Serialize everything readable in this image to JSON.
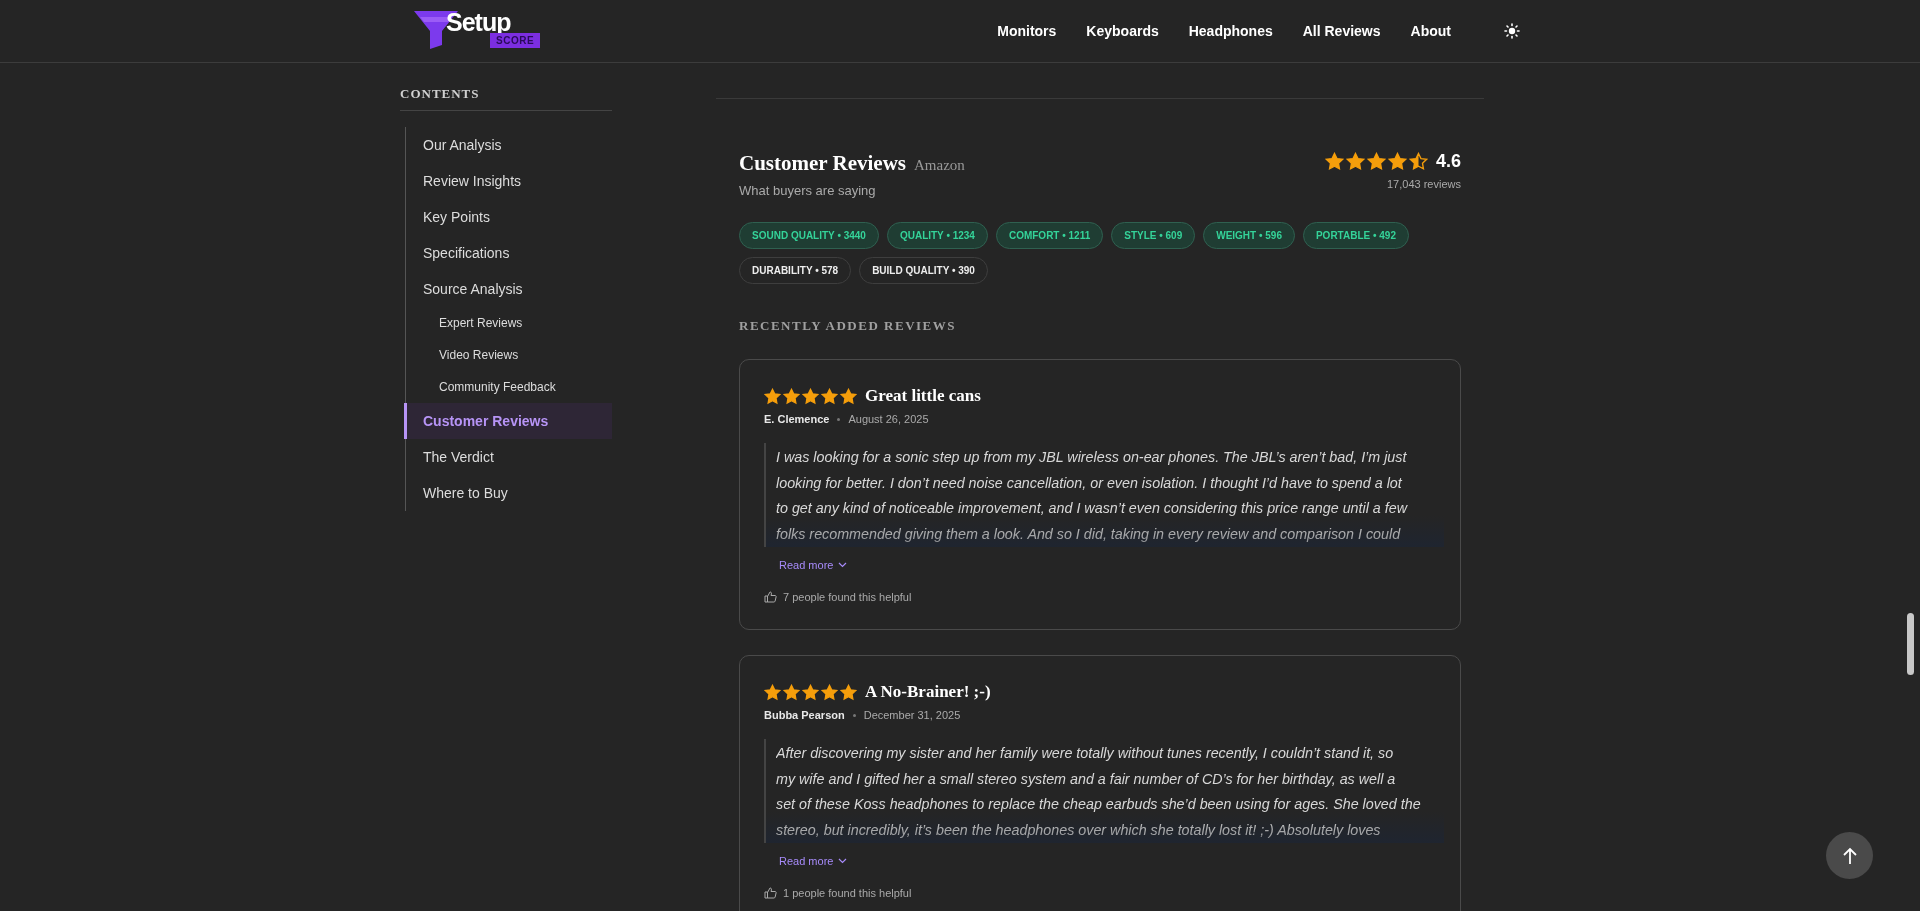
{
  "header": {
    "logo": {
      "word": "Setup",
      "badge": "SCORE"
    },
    "nav": [
      {
        "label": "Monitors"
      },
      {
        "label": "Keyboards"
      },
      {
        "label": "Headphones"
      },
      {
        "label": "All Reviews"
      },
      {
        "label": "About"
      }
    ]
  },
  "sidebar": {
    "title": "CONTENTS",
    "items": [
      {
        "label": "Our Analysis",
        "selected": false
      },
      {
        "label": "Review Insights",
        "selected": false
      },
      {
        "label": "Key Points",
        "selected": false
      },
      {
        "label": "Specifications",
        "selected": false
      },
      {
        "label": "Source Analysis",
        "selected": false,
        "children": [
          {
            "label": "Expert Reviews",
            "selected": false
          },
          {
            "label": "Video Reviews",
            "selected": false
          },
          {
            "label": "Community Feedback",
            "selected": false
          }
        ]
      },
      {
        "label": "Customer Reviews",
        "selected": true
      },
      {
        "label": "The Verdict",
        "selected": false
      },
      {
        "label": "Where to Buy",
        "selected": false
      }
    ]
  },
  "customer_reviews": {
    "title": "Customer Reviews",
    "source": "Amazon",
    "subtitle": "What buyers are saying",
    "stars": 4.5,
    "rating": "4.6",
    "count": "17,043 reviews",
    "tags": [
      {
        "label": "SOUND QUALITY • 3440",
        "highlighted": true
      },
      {
        "label": "QUALITY • 1234",
        "highlighted": true
      },
      {
        "label": "COMFORT • 1211",
        "highlighted": true
      },
      {
        "label": "STYLE • 609",
        "highlighted": true
      },
      {
        "label": "WEIGHT • 596",
        "highlighted": true
      },
      {
        "label": "PORTABLE • 492",
        "highlighted": true
      },
      {
        "label": "DURABILITY • 578",
        "highlighted": false
      },
      {
        "label": "BUILD QUALITY • 390",
        "highlighted": false
      }
    ],
    "recent_title": "RECENTLY ADDED REVIEWS",
    "reviews": [
      {
        "stars": 5,
        "title": "Great little cans",
        "author": "E. Clemence",
        "date": "August 26, 2025",
        "body": "I was looking for a sonic step up from my JBL wireless on-ear phones. The JBL’s aren’t bad, I’m just\nlooking for better. I don’t need noise cancellation, or even isolation. I thought I’d have to spend a lot\nto get any kind of noticeable improvement, and I wasn’t even considering this price range until a few\nfolks recommended giving them a look. And so I did, taking in every review and comparison I could",
        "read_more": "Read more",
        "helpful": "7 people found this helpful"
      },
      {
        "stars": 5,
        "title": "A No-Brainer! ;-)",
        "author": "Bubba Pearson",
        "date": "December 31, 2025",
        "body": "After discovering my sister and her family were totally without tunes recently, I couldn’t stand it, so\nmy wife and I gifted her a small stereo system and a fair number of CD’s for her birthday, as well a\nset of these Koss headphones to replace the cheap earbuds she’d been using for ages. She loved the\nstereo, but incredibly, it’s been the headphones over which she totally lost it! ;-) Absolutely loves",
        "read_more": "Read more",
        "helpful": "1 people found this helpful"
      }
    ]
  }
}
